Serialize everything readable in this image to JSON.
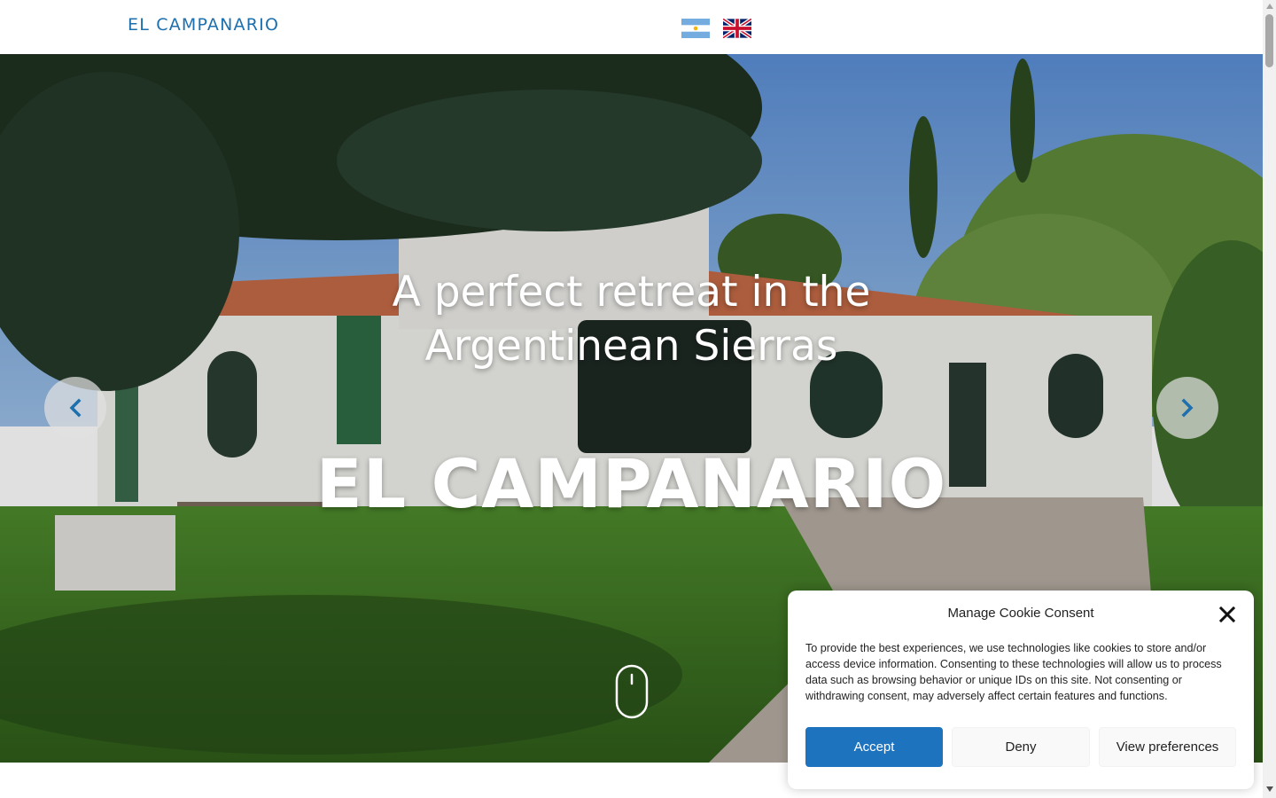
{
  "header": {
    "brand": "EL CAMPANARIO",
    "languages": [
      {
        "code": "es",
        "flag": "argentina-flag-icon"
      },
      {
        "code": "en",
        "flag": "uk-flag-icon"
      }
    ]
  },
  "hero": {
    "tagline_line1": "A perfect retreat in the",
    "tagline_line2": "Argentinean Sierras",
    "title": "EL CAMPANARIO",
    "prev_icon": "chevron-left-icon",
    "next_icon": "chevron-right-icon",
    "scroll_icon": "mouse-scroll-icon"
  },
  "cookie": {
    "title": "Manage Cookie Consent",
    "text": "To provide the best experiences, we use technologies like cookies to store and/or access device information. Consenting to these technologies will allow us to process data such as browsing behavior or unique IDs on this site. Not consenting or withdrawing consent, may adversely affect certain features and functions.",
    "accept_label": "Accept",
    "deny_label": "Deny",
    "preferences_label": "View preferences",
    "close_icon": "close-icon"
  },
  "colors": {
    "brand": "#1d6fad",
    "accept_button": "#1e73be",
    "arrow_icon": "#1d6fad"
  }
}
